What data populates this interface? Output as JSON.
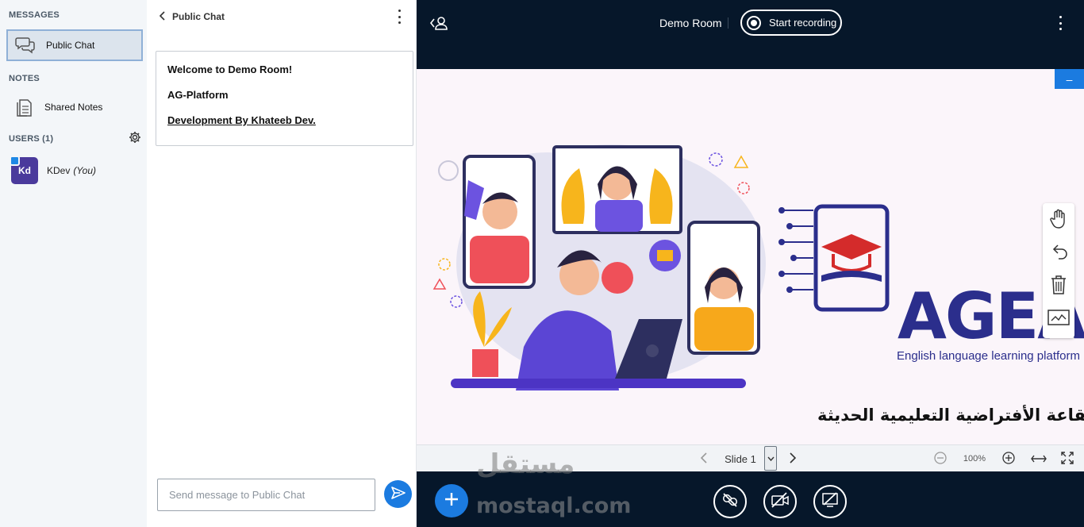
{
  "sidebar": {
    "messages_title": "MESSAGES",
    "public_chat_label": "Public Chat",
    "notes_title": "NOTES",
    "shared_notes_label": "Shared Notes",
    "users_title": "USERS (1)",
    "user": {
      "initials": "Kd",
      "name": "KDev",
      "you_label": "(You)"
    }
  },
  "chat": {
    "header_title": "Public Chat",
    "welcome_lines": [
      "Welcome to Demo Room!",
      "AG-Platform",
      "Development By Khateeb Dev."
    ],
    "input_placeholder": "Send message to Public Chat"
  },
  "topbar": {
    "room_name": "Demo Room",
    "record_label": "Start recording"
  },
  "slide": {
    "brand_name": "AGEA",
    "brand_subtitle": "English language learning platform",
    "arabic_title": "القاعة الأفتراضية التعليمية الحديثة",
    "minimize_label": "–"
  },
  "slide_controls": {
    "slide_label": "Slide 1",
    "zoom_value": "100%"
  },
  "watermark": {
    "arabic": "مستقل",
    "latin": "mostaql.com"
  },
  "colors": {
    "accent": "#1b7be0",
    "dark": "#06172a",
    "brand": "#2b2e8c",
    "avatar": "#4a3a9c"
  }
}
